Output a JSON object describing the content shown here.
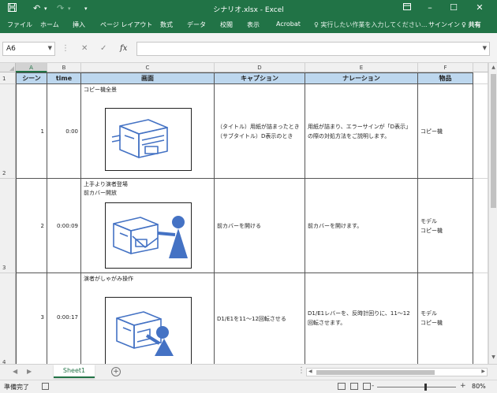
{
  "titlebar": {
    "title": "シナリオ.xlsx - Excel",
    "save_icon": "save-icon",
    "undo_icon": "undo-icon",
    "redo_icon": "redo-icon",
    "customize_icon": "customize-icon"
  },
  "ribbon": {
    "tabs": [
      "ファイル",
      "ホーム",
      "挿入",
      "ページ レイアウト",
      "数式",
      "データ",
      "校閲",
      "表示",
      "Acrobat"
    ],
    "tell_me": "♀ 実行したい作業を入力してください...",
    "sign_in": "サインイン",
    "share": "♀ 共有"
  },
  "formula_bar": {
    "name_box": "A6",
    "formula": "",
    "fx_label": "fx"
  },
  "columns": [
    "A",
    "B",
    "C",
    "D",
    "E",
    "F"
  ],
  "rows": [
    "1",
    "2",
    "3",
    "4"
  ],
  "headers": [
    "シーン",
    "time",
    "画面",
    "キャプション",
    "ナレーション",
    "物品"
  ],
  "table_rows": [
    {
      "scene": "1",
      "time": "0:00",
      "screen_desc": "コピー機全景",
      "caption": "（タイトル）用紙が詰まったとき\n（サブタイトル）D表示のとき",
      "narration": "用紙が詰まり、エラーサインが「D表示」の際の対処方法をご説明します。",
      "items": "コピー機"
    },
    {
      "scene": "2",
      "time": "0:00:09",
      "screen_desc": "上手より演者登場\n前カバー開放",
      "caption": "前カバーを開ける",
      "narration": "前カバーを開けます。",
      "items": "モデル\nコピー機"
    },
    {
      "scene": "3",
      "time": "0:00:17",
      "screen_desc": "演者がしゃがみ操作",
      "caption": "D1/E1を11～12回転させる",
      "narration": "D1/E1レバーを、反時計回りに、11～12回転させます。",
      "items": "モデル\nコピー機"
    }
  ],
  "sheets": {
    "active": "Sheet1"
  },
  "status": {
    "ready": "準備完了",
    "zoom": "80%",
    "zoom_minus": "-",
    "zoom_plus": "+"
  },
  "colors": {
    "excel_green": "#217346",
    "header_fill": "#bdd7ee",
    "illustration_blue": "#4472c4"
  }
}
